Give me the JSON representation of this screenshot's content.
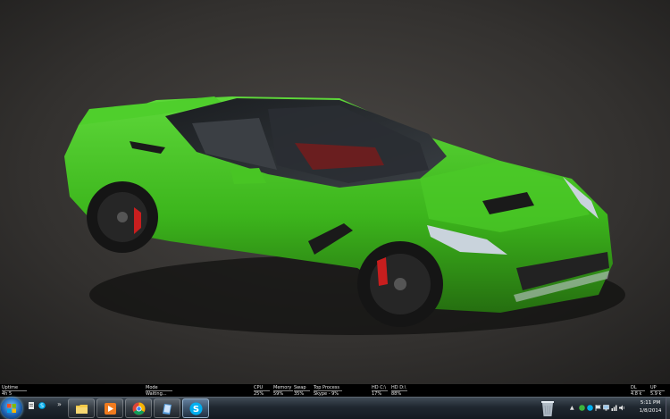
{
  "stats": {
    "uptime": {
      "label": "Uptime",
      "value": "4h 5"
    },
    "mode": {
      "label": "Mode",
      "value": "Waiting..."
    },
    "cpu": {
      "label": "CPU",
      "value": "25%"
    },
    "memory": {
      "label": "Memory",
      "value": "59%"
    },
    "swap": {
      "label": "Swap",
      "value": "35%"
    },
    "top_process": {
      "label": "Top Process",
      "value": "Skype - 9%"
    },
    "hdc": {
      "label": "HD C:\\",
      "value": "17%"
    },
    "hdd": {
      "label": "HD D:\\",
      "value": "88%"
    },
    "dl": {
      "label": "DL",
      "value": "4.8 k"
    },
    "up": {
      "label": "UP",
      "value": "5.9 k"
    }
  },
  "taskbar": {
    "pinned": [
      {
        "name": "file-explorer",
        "icon": "folder-icon"
      },
      {
        "name": "media-player",
        "icon": "play-icon"
      },
      {
        "name": "chrome",
        "icon": "chrome-icon"
      },
      {
        "name": "notes",
        "icon": "notes-icon"
      },
      {
        "name": "skype",
        "icon": "skype-icon",
        "active": true
      }
    ],
    "overflow": "»"
  },
  "clock": {
    "time": "5:11 PM",
    "date": "1/8/2014"
  },
  "colors": {
    "car": "#3fbf1f",
    "ground": "#2e2c2a",
    "taskbar": "#1f272f"
  }
}
